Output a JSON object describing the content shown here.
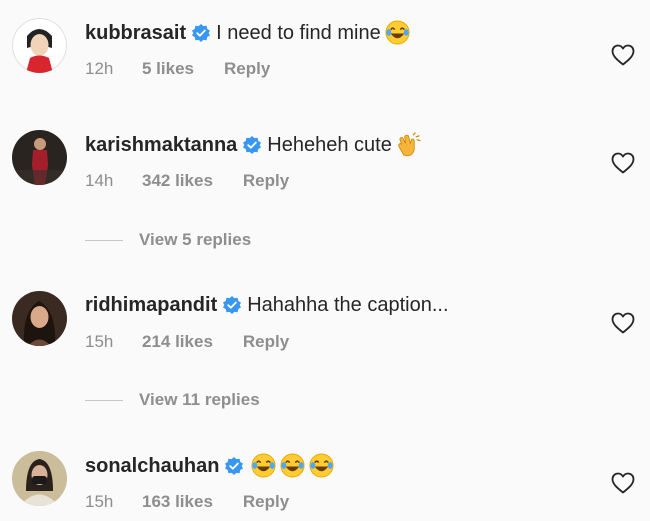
{
  "comments": [
    {
      "username": "kubbrasait",
      "text": "I need to find mine",
      "time": "12h",
      "likes": "5 likes",
      "reply": "Reply",
      "emojis": [
        "face-with-tears-of-joy-icon"
      ]
    },
    {
      "username": "karishmaktanna",
      "text": "Heheheh cute",
      "time": "14h",
      "likes": "342 likes",
      "reply": "Reply",
      "emojis": [
        "clapping-hands-icon"
      ]
    },
    {
      "username": "ridhimapandit",
      "text": "Hahahha the caption...",
      "time": "15h",
      "likes": "214 likes",
      "reply": "Reply",
      "emojis": []
    },
    {
      "username": "sonalchauhan",
      "text": "",
      "time": "15h",
      "likes": "163 likes",
      "reply": "Reply",
      "emojis": [
        "face-with-tears-of-joy-icon",
        "face-with-tears-of-joy-icon",
        "face-with-tears-of-joy-icon"
      ]
    }
  ],
  "view_replies": [
    {
      "label": "View 5 replies"
    },
    {
      "label": "View 11 replies"
    }
  ],
  "colors": {
    "verified": "#3897f0",
    "secondary_text": "#8e8e8e",
    "primary_text": "#262626",
    "background": "#fafafa"
  }
}
